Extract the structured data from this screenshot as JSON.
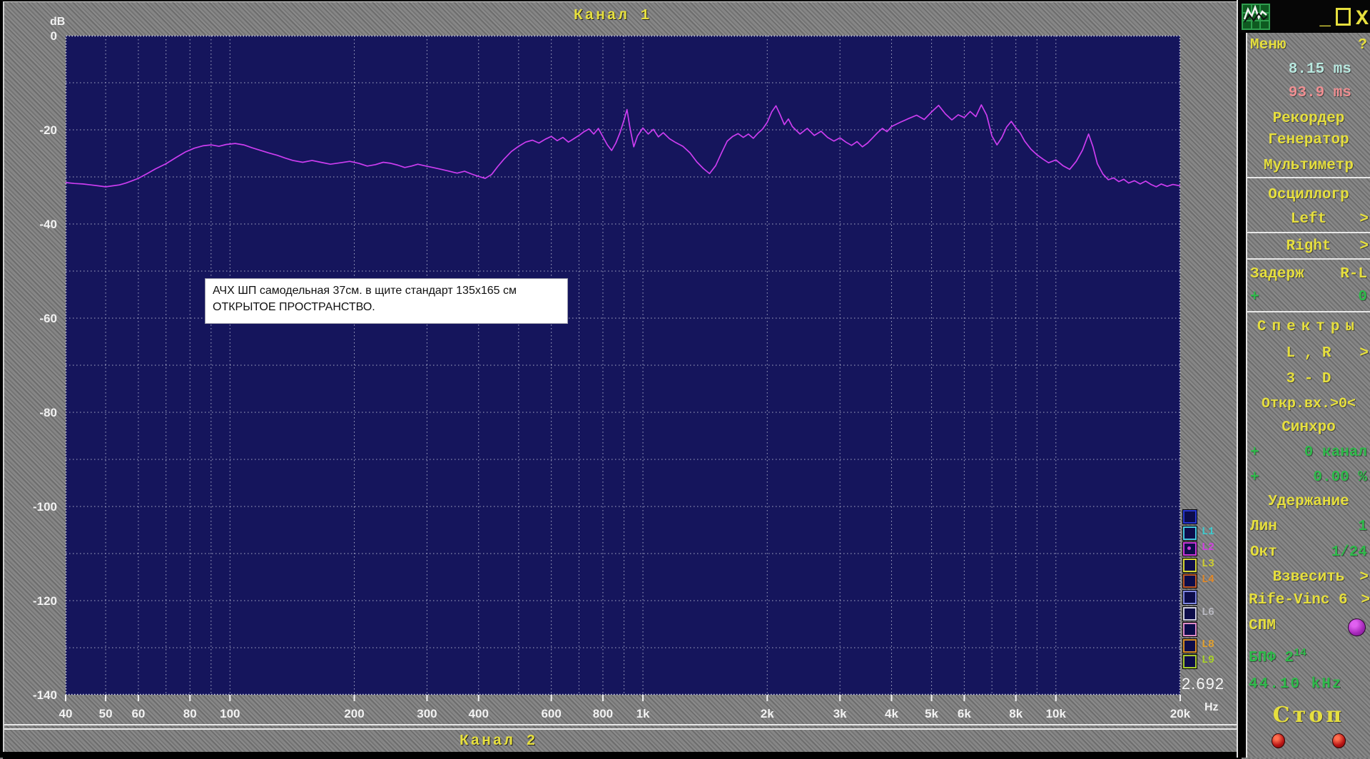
{
  "window": {
    "controls": {
      "minimize": "_",
      "close": "X"
    }
  },
  "titles": {
    "top": "Канал 1",
    "bottom": "Канал 2"
  },
  "axis": {
    "unit_y": "dB",
    "unit_x": "Hz"
  },
  "readout": {
    "value": "2.692"
  },
  "annotation": {
    "line1": "АЧХ  ШП  самодельная 37см.  в  щите  стандарт 135х165 см",
    "line2": "ОТКРЫТОЕ ПРОСТРАНСТВО."
  },
  "legend": {
    "items": [
      {
        "label": "",
        "box_color": "#2838d0",
        "label_color": "#2838d0",
        "checked": false
      },
      {
        "label": "L1",
        "box_color": "#48c8e0",
        "label_color": "#3cc8cc",
        "checked": false
      },
      {
        "label": "L2",
        "box_color": "#cc3ad8",
        "label_color": "#d040e0",
        "checked": true
      },
      {
        "label": "L3",
        "box_color": "#d8d838",
        "label_color": "#cccc30",
        "checked": false
      },
      {
        "label": "L4",
        "box_color": "#c05a28",
        "label_color": "#e08828",
        "checked": false
      },
      {
        "label": "",
        "box_color": "#8088e0",
        "label_color": "#8088e0",
        "checked": false
      },
      {
        "label": "L6",
        "box_color": "#d0d0e0",
        "label_color": "#b8b8c0",
        "checked": false
      },
      {
        "label": "",
        "box_color": "#e08cc8",
        "label_color": "#e08cc8",
        "checked": false
      },
      {
        "label": "L8",
        "box_color": "#d89028",
        "label_color": "#e0a030",
        "checked": false
      },
      {
        "label": "L9",
        "box_color": "#a8cc30",
        "label_color": "#a8d028",
        "checked": false
      }
    ]
  },
  "panel": {
    "menu": "Меню",
    "help": "?",
    "time1": "8.15 ms",
    "time2": "93.9 ms",
    "recorder": "Рекордер",
    "generator": "Генератор",
    "multimeter": "Мультиметр",
    "oscillograph": "Осциллогр",
    "left": "Left",
    "right": "Right",
    "arrow": ">",
    "delay_label": "Задерж",
    "delay_rl": "R-L",
    "delay_plus": "+",
    "delay_value": "0",
    "spectra": "Спектры",
    "lr": "L , R",
    "three_d": "3 - D",
    "open_input": "Откр.вх.>0<",
    "sync": "Синхро",
    "sync_ch_plus": "+",
    "sync_ch_value": "0 канал",
    "sync_pct_plus": "+",
    "sync_pct_value": "0.00 %",
    "hold": "Удержание",
    "lin_label": "Лин",
    "lin_value": "1",
    "oct_label": "Окт",
    "oct_value": "1/24",
    "weight": "Взвесить",
    "rife": "Rife-Vinc 6",
    "spm": "СПМ",
    "fft_label": "БПФ 2",
    "fft_exp": "14",
    "sample_rate": "44.10 kHz",
    "stop": "Стоп"
  },
  "chart_data": {
    "type": "line",
    "title": "Канал 1",
    "xlabel": "Hz",
    "ylabel": "dB",
    "x_scale": "log",
    "xlim": [
      40,
      20000
    ],
    "ylim": [
      -140,
      0
    ],
    "grid": true,
    "background": "#15155c",
    "grid_color": "#c4c8dc",
    "x_ticks": [
      [
        40,
        "40"
      ],
      [
        50,
        "50"
      ],
      [
        60,
        "60"
      ],
      [
        80,
        "80"
      ],
      [
        100,
        "100"
      ],
      [
        200,
        "200"
      ],
      [
        300,
        "300"
      ],
      [
        400,
        "400"
      ],
      [
        600,
        "600"
      ],
      [
        800,
        "800"
      ],
      [
        1000,
        "1k"
      ],
      [
        2000,
        "2k"
      ],
      [
        3000,
        "3k"
      ],
      [
        4000,
        "4k"
      ],
      [
        5000,
        "5k"
      ],
      [
        6000,
        "6k"
      ],
      [
        8000,
        "8k"
      ],
      [
        10000,
        "10k"
      ],
      [
        20000,
        "20k"
      ]
    ],
    "x_grid": [
      50,
      60,
      70,
      80,
      90,
      100,
      200,
      300,
      400,
      500,
      600,
      700,
      800,
      900,
      1000,
      2000,
      3000,
      4000,
      5000,
      6000,
      7000,
      8000,
      9000,
      10000
    ],
    "y_ticks": [
      0,
      -20,
      -40,
      -60,
      -80,
      -100,
      -120,
      -140
    ],
    "y_grid": [
      -10,
      -20,
      -30,
      -40,
      -50,
      -60,
      -70,
      -80,
      -90,
      -100,
      -110,
      -120,
      -130
    ],
    "series": [
      {
        "name": "L2",
        "color": "#cc3df0",
        "points": [
          [
            40,
            -31.2
          ],
          [
            42,
            -31.4
          ],
          [
            44,
            -31.5
          ],
          [
            46,
            -31.7
          ],
          [
            48,
            -31.9
          ],
          [
            50,
            -32.1
          ],
          [
            52,
            -31.9
          ],
          [
            54,
            -31.7
          ],
          [
            56,
            -31.3
          ],
          [
            58,
            -30.8
          ],
          [
            60,
            -30.3
          ],
          [
            63,
            -29.3
          ],
          [
            66,
            -28.3
          ],
          [
            70,
            -27.2
          ],
          [
            74,
            -25.9
          ],
          [
            78,
            -24.7
          ],
          [
            82,
            -23.9
          ],
          [
            86,
            -23.4
          ],
          [
            90,
            -23.2
          ],
          [
            94,
            -23.5
          ],
          [
            98,
            -23.1
          ],
          [
            103,
            -22.9
          ],
          [
            108,
            -23.2
          ],
          [
            113,
            -23.8
          ],
          [
            118,
            -24.3
          ],
          [
            124,
            -24.9
          ],
          [
            130,
            -25.4
          ],
          [
            136,
            -26.0
          ],
          [
            142,
            -26.5
          ],
          [
            150,
            -26.9
          ],
          [
            158,
            -26.5
          ],
          [
            166,
            -26.9
          ],
          [
            175,
            -27.3
          ],
          [
            185,
            -27.0
          ],
          [
            195,
            -26.7
          ],
          [
            205,
            -27.1
          ],
          [
            215,
            -27.7
          ],
          [
            225,
            -27.4
          ],
          [
            235,
            -26.9
          ],
          [
            245,
            -27.1
          ],
          [
            255,
            -27.5
          ],
          [
            265,
            -28.0
          ],
          [
            275,
            -27.7
          ],
          [
            285,
            -27.3
          ],
          [
            295,
            -27.6
          ],
          [
            310,
            -28.0
          ],
          [
            325,
            -28.4
          ],
          [
            340,
            -28.8
          ],
          [
            355,
            -29.2
          ],
          [
            370,
            -28.8
          ],
          [
            385,
            -29.4
          ],
          [
            400,
            -29.9
          ],
          [
            415,
            -30.3
          ],
          [
            430,
            -29.5
          ],
          [
            445,
            -27.8
          ],
          [
            460,
            -26.3
          ],
          [
            480,
            -24.6
          ],
          [
            500,
            -23.5
          ],
          [
            520,
            -22.6
          ],
          [
            540,
            -22.2
          ],
          [
            560,
            -22.8
          ],
          [
            580,
            -22.0
          ],
          [
            600,
            -21.4
          ],
          [
            620,
            -22.3
          ],
          [
            640,
            -21.6
          ],
          [
            660,
            -22.6
          ],
          [
            680,
            -21.9
          ],
          [
            700,
            -21.2
          ],
          [
            720,
            -20.4
          ],
          [
            740,
            -19.8
          ],
          [
            760,
            -20.9
          ],
          [
            780,
            -19.7
          ],
          [
            800,
            -21.5
          ],
          [
            820,
            -23.2
          ],
          [
            840,
            -24.4
          ],
          [
            860,
            -22.8
          ],
          [
            880,
            -20.6
          ],
          [
            900,
            -17.9
          ],
          [
            915,
            -15.7
          ],
          [
            930,
            -19.5
          ],
          [
            950,
            -23.6
          ],
          [
            970,
            -21.3
          ],
          [
            1000,
            -19.6
          ],
          [
            1030,
            -20.9
          ],
          [
            1060,
            -19.9
          ],
          [
            1090,
            -21.5
          ],
          [
            1120,
            -20.6
          ],
          [
            1160,
            -21.9
          ],
          [
            1200,
            -22.7
          ],
          [
            1250,
            -23.5
          ],
          [
            1300,
            -24.9
          ],
          [
            1350,
            -26.8
          ],
          [
            1400,
            -28.2
          ],
          [
            1450,
            -29.3
          ],
          [
            1500,
            -27.6
          ],
          [
            1550,
            -24.9
          ],
          [
            1600,
            -22.4
          ],
          [
            1650,
            -21.4
          ],
          [
            1700,
            -20.8
          ],
          [
            1750,
            -21.6
          ],
          [
            1800,
            -20.9
          ],
          [
            1850,
            -21.8
          ],
          [
            1900,
            -20.7
          ],
          [
            1950,
            -19.8
          ],
          [
            2000,
            -18.4
          ],
          [
            2050,
            -16.2
          ],
          [
            2100,
            -14.9
          ],
          [
            2150,
            -16.8
          ],
          [
            2200,
            -18.9
          ],
          [
            2250,
            -17.7
          ],
          [
            2300,
            -19.3
          ],
          [
            2400,
            -20.9
          ],
          [
            2500,
            -19.7
          ],
          [
            2600,
            -21.2
          ],
          [
            2700,
            -20.3
          ],
          [
            2800,
            -21.6
          ],
          [
            2900,
            -22.4
          ],
          [
            3000,
            -21.7
          ],
          [
            3100,
            -22.6
          ],
          [
            3200,
            -23.3
          ],
          [
            3300,
            -22.5
          ],
          [
            3400,
            -23.6
          ],
          [
            3500,
            -22.8
          ],
          [
            3600,
            -21.7
          ],
          [
            3700,
            -20.6
          ],
          [
            3800,
            -19.7
          ],
          [
            3900,
            -20.4
          ],
          [
            4000,
            -19.3
          ],
          [
            4200,
            -18.4
          ],
          [
            4400,
            -17.6
          ],
          [
            4600,
            -16.9
          ],
          [
            4800,
            -17.8
          ],
          [
            5000,
            -16.2
          ],
          [
            5200,
            -14.8
          ],
          [
            5400,
            -16.6
          ],
          [
            5600,
            -17.9
          ],
          [
            5800,
            -16.8
          ],
          [
            6000,
            -17.4
          ],
          [
            6200,
            -16.1
          ],
          [
            6400,
            -17.2
          ],
          [
            6600,
            -14.7
          ],
          [
            6800,
            -16.9
          ],
          [
            7000,
            -21.3
          ],
          [
            7200,
            -23.2
          ],
          [
            7400,
            -21.6
          ],
          [
            7600,
            -19.4
          ],
          [
            7800,
            -18.2
          ],
          [
            8000,
            -19.6
          ],
          [
            8200,
            -20.7
          ],
          [
            8400,
            -22.4
          ],
          [
            8700,
            -24.1
          ],
          [
            9000,
            -25.3
          ],
          [
            9300,
            -26.2
          ],
          [
            9600,
            -27.0
          ],
          [
            10000,
            -26.4
          ],
          [
            10400,
            -27.6
          ],
          [
            10800,
            -28.4
          ],
          [
            11200,
            -26.7
          ],
          [
            11600,
            -24.3
          ],
          [
            12000,
            -20.9
          ],
          [
            12300,
            -23.6
          ],
          [
            12600,
            -27.2
          ],
          [
            13000,
            -29.4
          ],
          [
            13400,
            -30.6
          ],
          [
            13800,
            -30.2
          ],
          [
            14200,
            -31.0
          ],
          [
            14600,
            -30.5
          ],
          [
            15000,
            -31.3
          ],
          [
            15500,
            -30.8
          ],
          [
            16000,
            -31.5
          ],
          [
            16500,
            -30.9
          ],
          [
            17000,
            -31.6
          ],
          [
            17500,
            -32.1
          ],
          [
            18000,
            -31.5
          ],
          [
            18600,
            -32.0
          ],
          [
            19200,
            -31.6
          ],
          [
            20000,
            -31.9
          ]
        ]
      }
    ]
  }
}
